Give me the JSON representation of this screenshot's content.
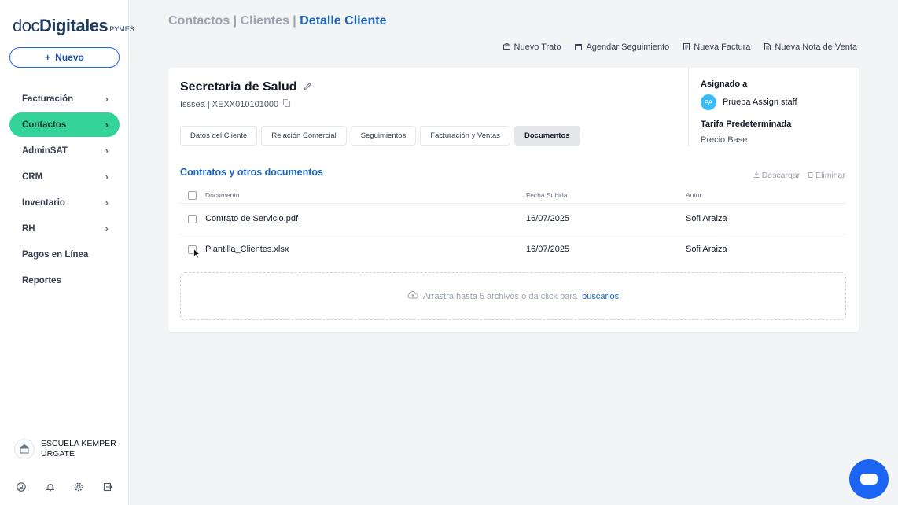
{
  "logo": {
    "doc": "doc",
    "digitales": "Digitales",
    "pymes": "PYMES"
  },
  "new_button": {
    "icon": "+",
    "label": "Nuevo"
  },
  "nav": [
    {
      "label": "Facturación",
      "chevron": "›",
      "active": false
    },
    {
      "label": "Contactos",
      "chevron": "›",
      "active": true
    },
    {
      "label": "AdminSAT",
      "chevron": "›",
      "active": false
    },
    {
      "label": "CRM",
      "chevron": "›",
      "active": false
    },
    {
      "label": "Inventario",
      "chevron": "›",
      "active": false
    },
    {
      "label": "RH",
      "chevron": "›",
      "active": false
    },
    {
      "label": "Pagos en Línea",
      "chevron": "",
      "active": false
    },
    {
      "label": "Reportes",
      "chevron": "",
      "active": false
    }
  ],
  "org": {
    "name": "ESCUELA KEMPER URGATE"
  },
  "breadcrumb": {
    "part1": "Contactos",
    "sep1": " | ",
    "part2": "Clientes",
    "sep2": " | ",
    "current": "Detalle Cliente"
  },
  "actions": [
    {
      "label": "Nuevo Trato",
      "icon": "briefcase-icon"
    },
    {
      "label": "Agendar Seguimiento",
      "icon": "calendar-icon"
    },
    {
      "label": "Nueva Factura",
      "icon": "invoice-icon"
    },
    {
      "label": "Nueva Nota de Venta",
      "icon": "note-icon"
    }
  ],
  "client": {
    "name": "Secretaria de Salud",
    "subtitle": "Isssea | XEXX010101000"
  },
  "assignment": {
    "assigned_label": "Asignado a",
    "initials": "PA",
    "person": "Prueba Assign staff",
    "tariff_label": "Tarifa Predeterminada",
    "tariff_value": "Precio Base"
  },
  "tabs": [
    {
      "label": "Datos del Cliente",
      "active": false
    },
    {
      "label": "Relación Comercial",
      "active": false
    },
    {
      "label": "Seguimientos",
      "active": false
    },
    {
      "label": "Facturación y Ventas",
      "active": false
    },
    {
      "label": "Documentos",
      "active": true
    }
  ],
  "documents": {
    "title": "Contratos y otros documentos",
    "download_label": "Descargar",
    "delete_label": "Eliminar",
    "columns": {
      "doc": "Documento",
      "date": "Fecha Subida",
      "author": "Autor"
    },
    "rows": [
      {
        "name": "Contrato de Servicio.pdf",
        "date": "16/07/2025",
        "author": "Sofi Araiza"
      },
      {
        "name": "Plantilla_Clientes.xlsx",
        "date": "16/07/2025",
        "author": "Sofi Araiza"
      }
    ],
    "dropzone_text": "Arrastra hasta 5 archivos o da click para",
    "dropzone_link": "buscarlos"
  },
  "colors": {
    "accent": "#1c64f2",
    "active_nav": "#34d399",
    "title_blue": "#1c64b8"
  }
}
